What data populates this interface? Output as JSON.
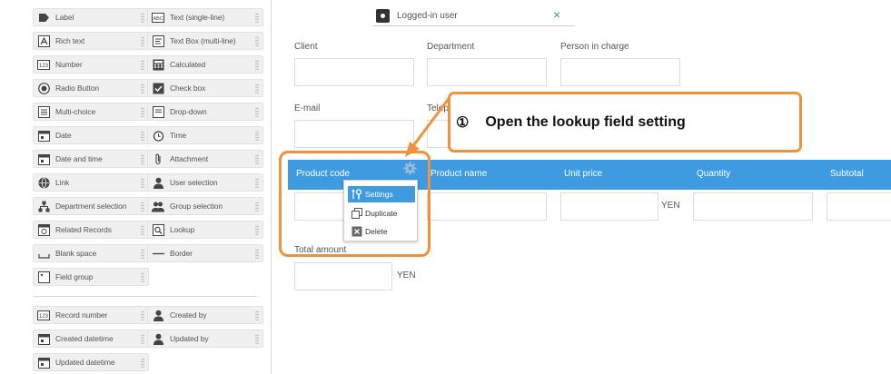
{
  "palette": {
    "col1": [
      {
        "label": "Label",
        "icon": "label-tag-icon"
      },
      {
        "label": "Rich text",
        "icon": "rich-text-icon"
      },
      {
        "label": "Number",
        "icon": "number-icon"
      },
      {
        "label": "Radio Button",
        "icon": "radio-button-icon"
      },
      {
        "label": "Multi-choice",
        "icon": "multi-choice-icon"
      },
      {
        "label": "Date",
        "icon": "date-icon"
      },
      {
        "label": "Date and time",
        "icon": "date-time-icon"
      },
      {
        "label": "Link",
        "icon": "link-globe-icon"
      },
      {
        "label": "Department selection",
        "icon": "department-icon"
      },
      {
        "label": "Related Records",
        "icon": "related-records-icon"
      },
      {
        "label": "Blank space",
        "icon": "blank-space-icon"
      },
      {
        "label": "Field group",
        "icon": "field-group-icon"
      }
    ],
    "col2": [
      {
        "label": "Text (single-line)",
        "icon": "text-single-line-icon"
      },
      {
        "label": "Text Box (multi-line)",
        "icon": "text-box-multiline-icon"
      },
      {
        "label": "Calculated",
        "icon": "calculator-icon"
      },
      {
        "label": "Check box",
        "icon": "check-box-icon"
      },
      {
        "label": "Drop-down",
        "icon": "drop-down-icon"
      },
      {
        "label": "Time",
        "icon": "time-clock-icon"
      },
      {
        "label": "Attachment",
        "icon": "attachment-icon"
      },
      {
        "label": "User selection",
        "icon": "user-icon"
      },
      {
        "label": "Group selection",
        "icon": "group-icon"
      },
      {
        "label": "Lookup",
        "icon": "lookup-icon"
      },
      {
        "label": "Border",
        "icon": "border-line-icon"
      }
    ],
    "system_col1": [
      {
        "label": "Record number",
        "icon": "record-number-icon"
      },
      {
        "label": "Created datetime",
        "icon": "created-datetime-icon"
      },
      {
        "label": "Updated datetime",
        "icon": "updated-datetime-icon"
      }
    ],
    "system_col2": [
      {
        "label": "Created by",
        "icon": "created-by-user-icon"
      },
      {
        "label": "Updated by",
        "icon": "updated-by-user-icon"
      }
    ]
  },
  "form": {
    "logged_in_user": "Logged-in user",
    "client": "Client",
    "department": "Department",
    "person_in_charge": "Person in charge",
    "email": "E-mail",
    "telephone_partial": "Telep",
    "total_amount": "Total amount",
    "yen": "YEN"
  },
  "table": {
    "headers": [
      "Product code",
      "Product name",
      "Unit price",
      "Quantity",
      "Subtotal"
    ],
    "unit_price_suffix": "YEN"
  },
  "menu": {
    "items": [
      {
        "label": "Settings",
        "icon": "settings-wrench-icon",
        "active": true
      },
      {
        "label": "Duplicate",
        "icon": "duplicate-icon",
        "active": false
      },
      {
        "label": "Delete",
        "icon": "delete-icon",
        "active": false
      }
    ]
  },
  "callout": {
    "number": "①",
    "text": "Open the lookup field setting"
  },
  "colors": {
    "table_header": "#3e9be0",
    "callout_border": "#f0923a"
  }
}
